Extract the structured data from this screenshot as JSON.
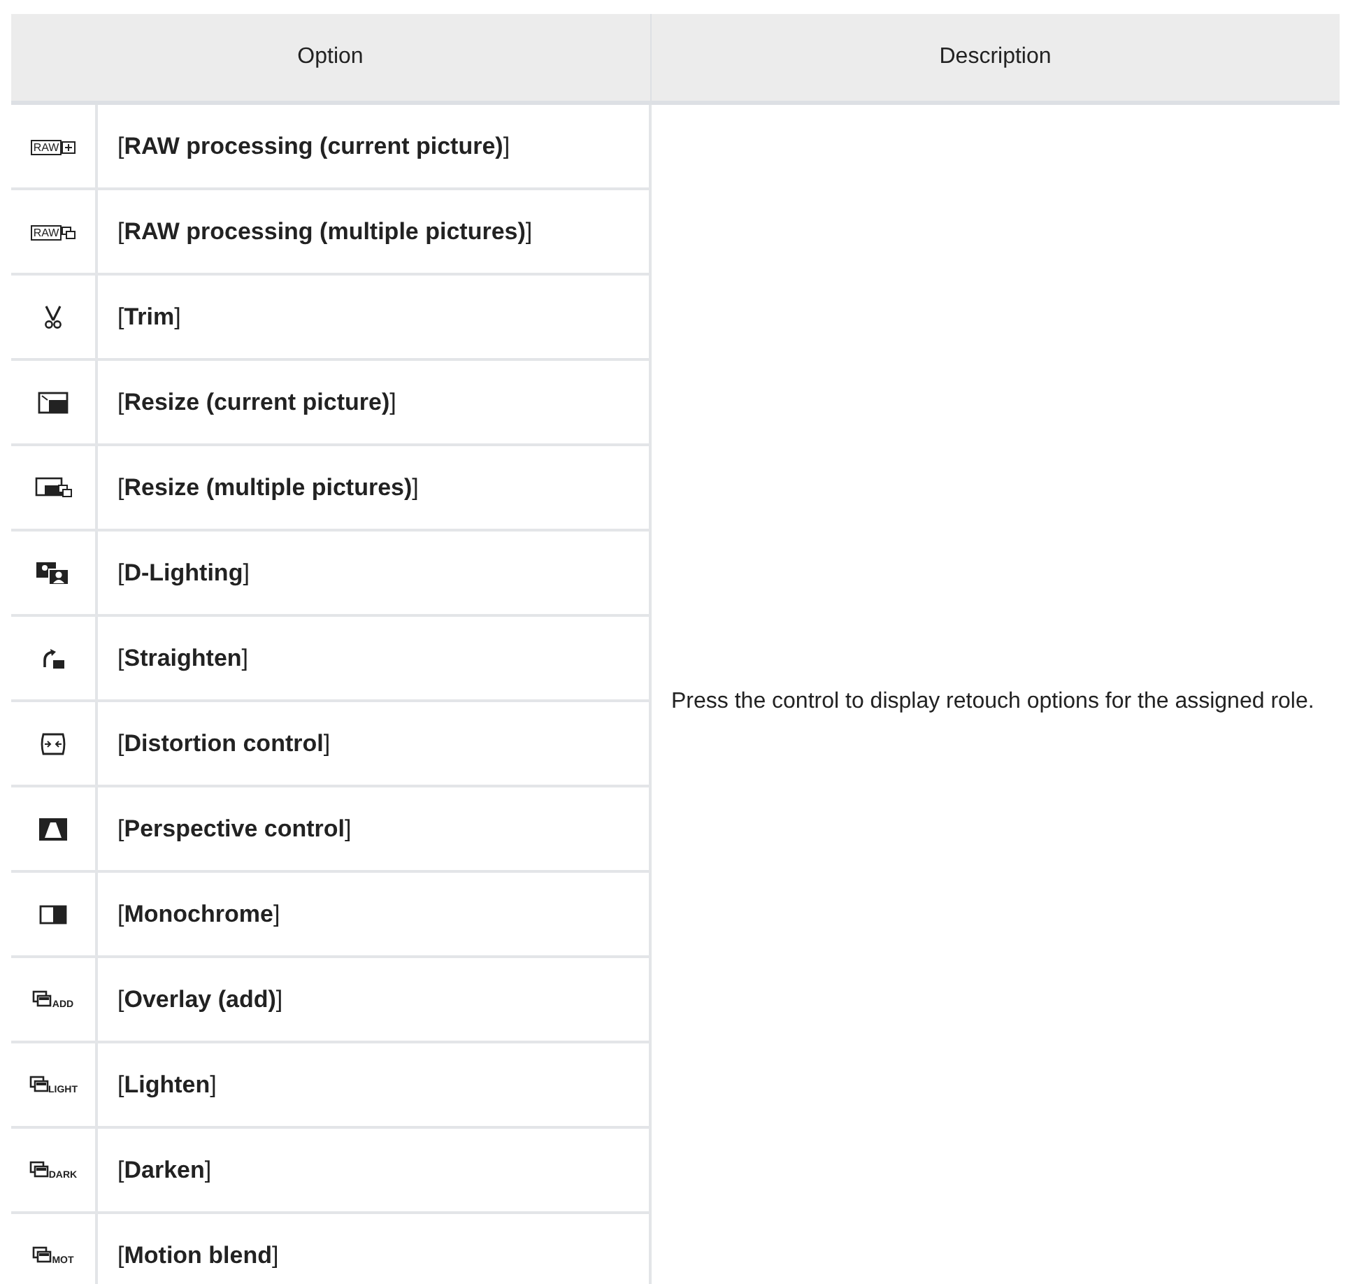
{
  "table": {
    "columns": [
      "Option",
      "Description"
    ],
    "rows": [
      {
        "kind": "raw-current",
        "icon_text": "RAW",
        "option": "[**RAW processing (current picture)**]"
      },
      {
        "kind": "raw-multiple",
        "icon_text": "RAW",
        "option": "[**RAW processing (multiple pictures)**]"
      },
      {
        "kind": "trim",
        "option": "[**Trim**]"
      },
      {
        "kind": "resize-current",
        "option": "[**Resize (current picture)**]"
      },
      {
        "kind": "resize-multiple",
        "option": "[**Resize (multiple pictures)**]"
      },
      {
        "kind": "d-lighting",
        "option": "[**D-Lighting**]"
      },
      {
        "kind": "straighten",
        "option": "[**Straighten**]"
      },
      {
        "kind": "distortion",
        "option": "[**Distortion control**]"
      },
      {
        "kind": "perspective",
        "option": "[**Perspective control**]"
      },
      {
        "kind": "monochrome",
        "option": "[**Monochrome**]"
      },
      {
        "kind": "overlay",
        "icon_text": "ADD",
        "option": "[**Overlay (add)**]"
      },
      {
        "kind": "overlay",
        "icon_text": "LIGHT",
        "option": "[**Lighten**]"
      },
      {
        "kind": "overlay",
        "icon_text": "DARK",
        "option": "[**Darken**]"
      },
      {
        "kind": "overlay",
        "icon_text": "MOT",
        "option": "[**Motion blend**]"
      }
    ],
    "description": "Press the control to display retouch options for the assigned role."
  }
}
